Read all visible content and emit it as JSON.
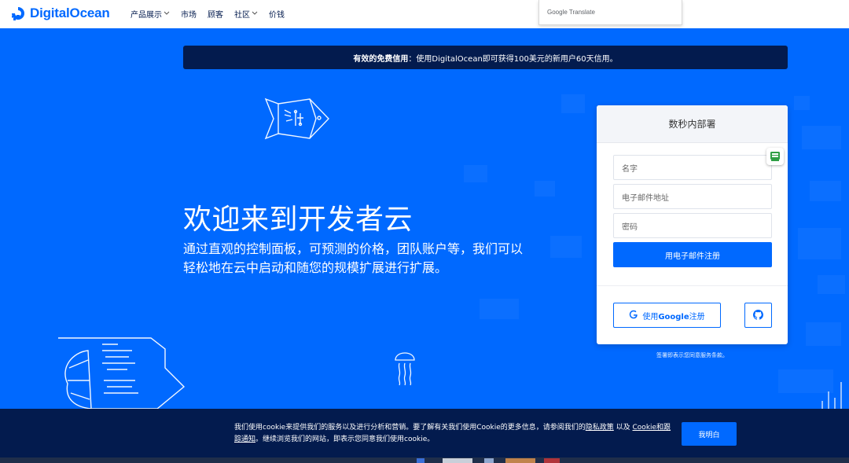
{
  "brand": {
    "name": "DigitalOcean"
  },
  "nav": {
    "items": [
      {
        "label": "产品展示",
        "has_dropdown": true
      },
      {
        "label": "市场",
        "has_dropdown": false
      },
      {
        "label": "顾客",
        "has_dropdown": false
      },
      {
        "label": "社区",
        "has_dropdown": true
      },
      {
        "label": "价钱",
        "has_dropdown": false
      }
    ]
  },
  "translate_widget": {
    "label": "Google Translate"
  },
  "banner": {
    "strong": "有效的免费信用",
    "text": "：使用DigitalOcean即可获得100美元的新用户60天信用。"
  },
  "hero": {
    "title": "欢迎来到开发者云",
    "subtitle": "通过直观的控制面板，可预测的价格，团队账户等，我们可以轻松地在云中启动和随您的规模扩展进行扩展。"
  },
  "signup": {
    "heading": "数秒内部署",
    "name_placeholder": "名字",
    "email_placeholder": "电子邮件地址",
    "password_placeholder": "密码",
    "submit_label": "用电子邮件注册",
    "google_prefix": "使用",
    "google_strong": "Google",
    "google_suffix": "注册",
    "terms": "签署即表示您同意服务条款。"
  },
  "cookie": {
    "text_1": "我们使用cookie来提供我们的服务以及进行分析和营销。要了解有关我们使用Cookie的更多信息，请参阅我们的",
    "privacy_link": "隐私政策",
    "text_2": " 以及 ",
    "cookie_link": "Cookie和跟踪通知",
    "text_3": "。继续浏览我们的网站，即表示您同意我们使用cookie。",
    "accept_label": "我明白"
  },
  "colors": {
    "primary": "#0069ff",
    "navy": "#031b4e",
    "white": "#ffffff"
  },
  "icons": {
    "logo": "digitalocean-logo-icon",
    "google": "google-g-icon",
    "github": "github-icon",
    "extension": "extension-icon"
  }
}
